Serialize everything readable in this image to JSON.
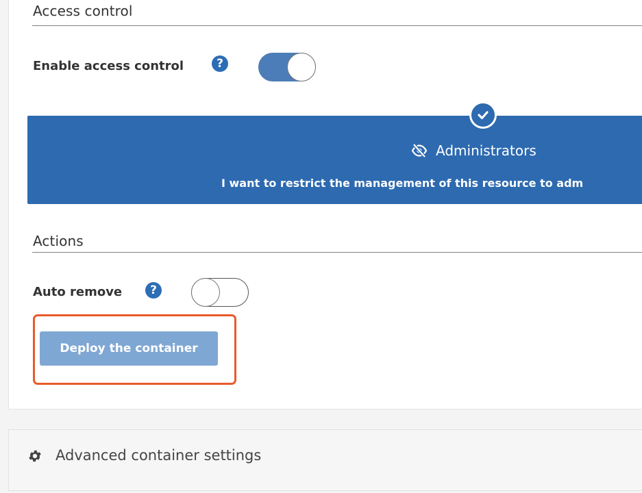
{
  "access_control": {
    "section_title": "Access control",
    "enable_label": "Enable access control",
    "help_glyph": "?",
    "enabled": true,
    "option": {
      "title": "Administrators",
      "description": "I want to restrict the management of this resource to adm",
      "selected": true,
      "icon": "eye-slash-icon"
    }
  },
  "actions": {
    "section_title": "Actions",
    "auto_remove_label": "Auto remove",
    "help_glyph": "?",
    "auto_remove_enabled": false,
    "deploy_label": "Deploy the container"
  },
  "advanced": {
    "label": "Advanced container settings",
    "icon": "gear-icon"
  },
  "colors": {
    "accent": "#2d6ab0",
    "highlight": "#e85a2b",
    "deploy_button": "#7fa7d3"
  }
}
